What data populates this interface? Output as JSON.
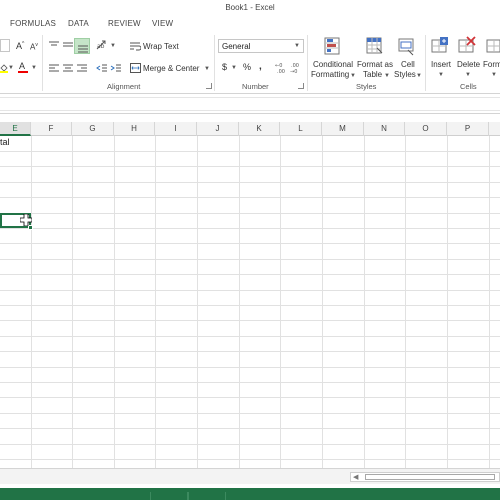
{
  "window": {
    "title": "Book1 - Excel"
  },
  "tabs": [
    "FORMULAS",
    "DATA",
    "REVIEW",
    "VIEW"
  ],
  "ribbon": {
    "alignment": {
      "wrap_text": "Wrap Text",
      "merge_center": "Merge & Center",
      "label": "Alignment"
    },
    "number": {
      "format_value": "General",
      "currency_symbol": "$",
      "percent_symbol": "%",
      "comma_symbol": ",",
      "label": "Number"
    },
    "styles": {
      "conditional_line1": "Conditional",
      "conditional_line2": "Formatting",
      "format_table_line1": "Format as",
      "format_table_line2": "Table",
      "cell_styles_line1": "Cell",
      "cell_styles_line2": "Styles",
      "label": "Styles"
    },
    "cells": {
      "insert": "Insert",
      "delete": "Delete",
      "format": "Form",
      "label": "Cells"
    },
    "font": {
      "grow_label": "A",
      "shrink_label": "A",
      "font_color_label": "A"
    }
  },
  "grid": {
    "columns": [
      "E",
      "F",
      "G",
      "H",
      "I",
      "J",
      "K",
      "L",
      "M",
      "N",
      "O",
      "P"
    ],
    "active_column": "E",
    "cells": {
      "e1": "tal"
    }
  },
  "colors": {
    "accent": "#217346",
    "highlight": "#c5e5c8"
  }
}
